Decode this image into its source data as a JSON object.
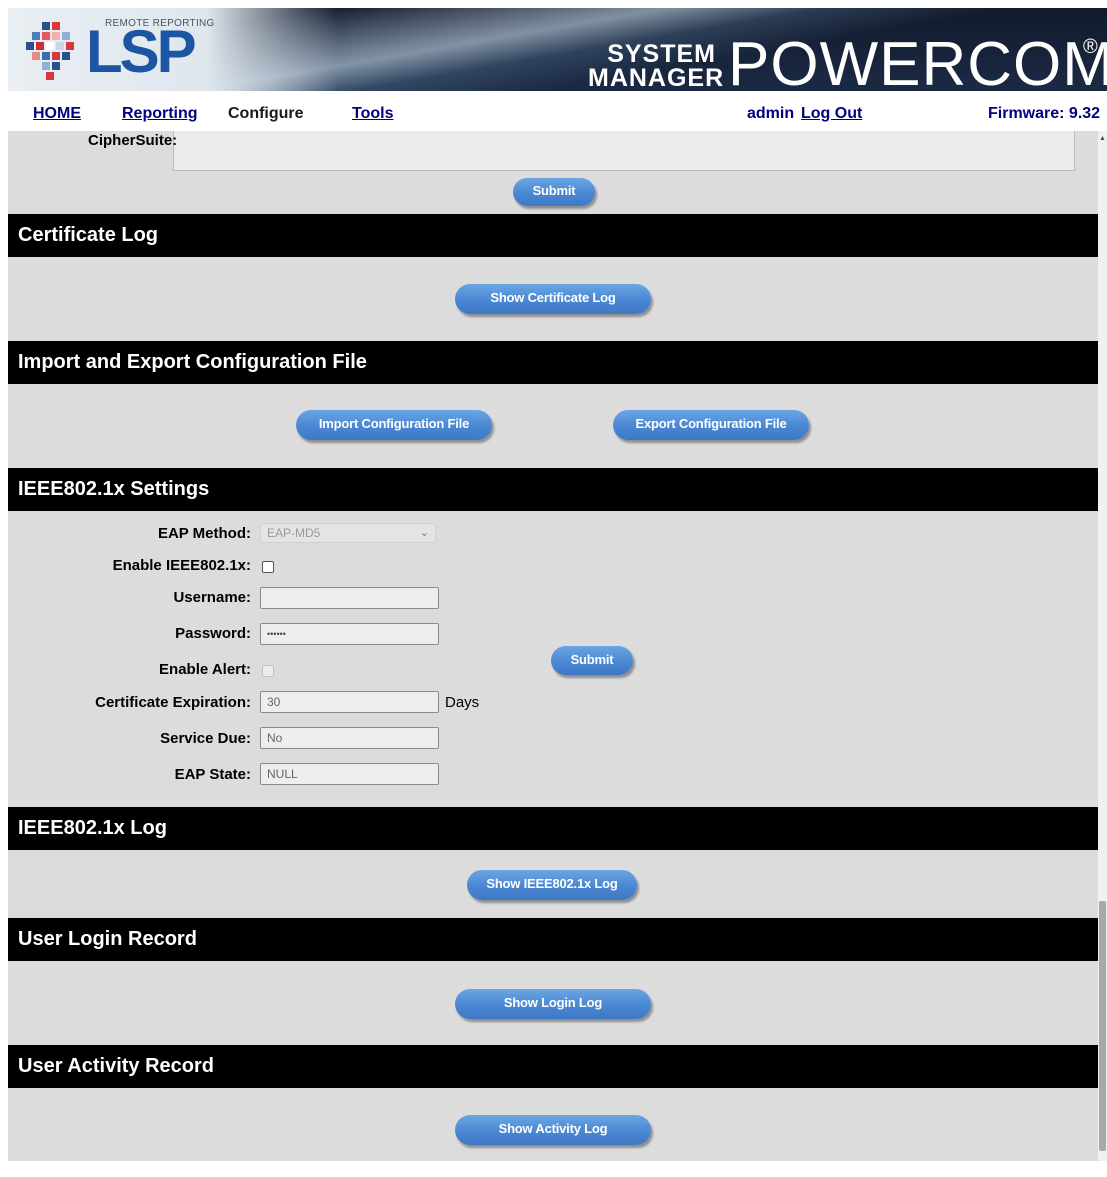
{
  "header": {
    "logo_small": "REMOTE REPORTING",
    "logo_main": "LSP",
    "brand_line1": "SYSTEM",
    "brand_line2": "MANAGER",
    "brand_name": "POWERCOM",
    "brand_mark": "®"
  },
  "nav": {
    "home": "HOME",
    "reporting": "Reporting",
    "configure": "Configure",
    "tools": "Tools",
    "user": "admin",
    "logout": "Log Out",
    "firmware": "Firmware: 9.32"
  },
  "ssl": {
    "ciphersuite_label": "CipherSuite:",
    "submit_label": "Submit"
  },
  "certificate_log": {
    "title": "Certificate Log",
    "button": "Show Certificate Log"
  },
  "import_export": {
    "title": "Import and Export Configuration File",
    "import_button": "Import Configuration File",
    "export_button": "Export Configuration File"
  },
  "ieee8021x": {
    "title": "IEEE802.1x Settings",
    "eap_method_label": "EAP Method:",
    "eap_method_value": "EAP-MD5",
    "enable_label": "Enable IEEE802.1x:",
    "enable_checked": false,
    "username_label": "Username:",
    "username_value": "",
    "password_label": "Password:",
    "password_value": "••••••",
    "enable_alert_label": "Enable Alert:",
    "enable_alert_checked": false,
    "cert_exp_label": "Certificate Expiration:",
    "cert_exp_value": "30",
    "cert_exp_unit": "Days",
    "service_due_label": "Service Due:",
    "service_due_value": "No",
    "eap_state_label": "EAP State:",
    "eap_state_value": "NULL",
    "submit_label": "Submit"
  },
  "ieee_log": {
    "title": "IEEE802.1x Log",
    "button": "Show IEEE802.1x Log"
  },
  "login_record": {
    "title": "User Login Record",
    "button": "Show Login Log"
  },
  "activity_record": {
    "title": "User Activity Record",
    "button": "Show Activity Log"
  },
  "colors": {
    "nav_link": "#000080",
    "section_header_bg": "#000000",
    "content_bg": "#dcdcdc",
    "button_blue": "#4a87d2"
  }
}
